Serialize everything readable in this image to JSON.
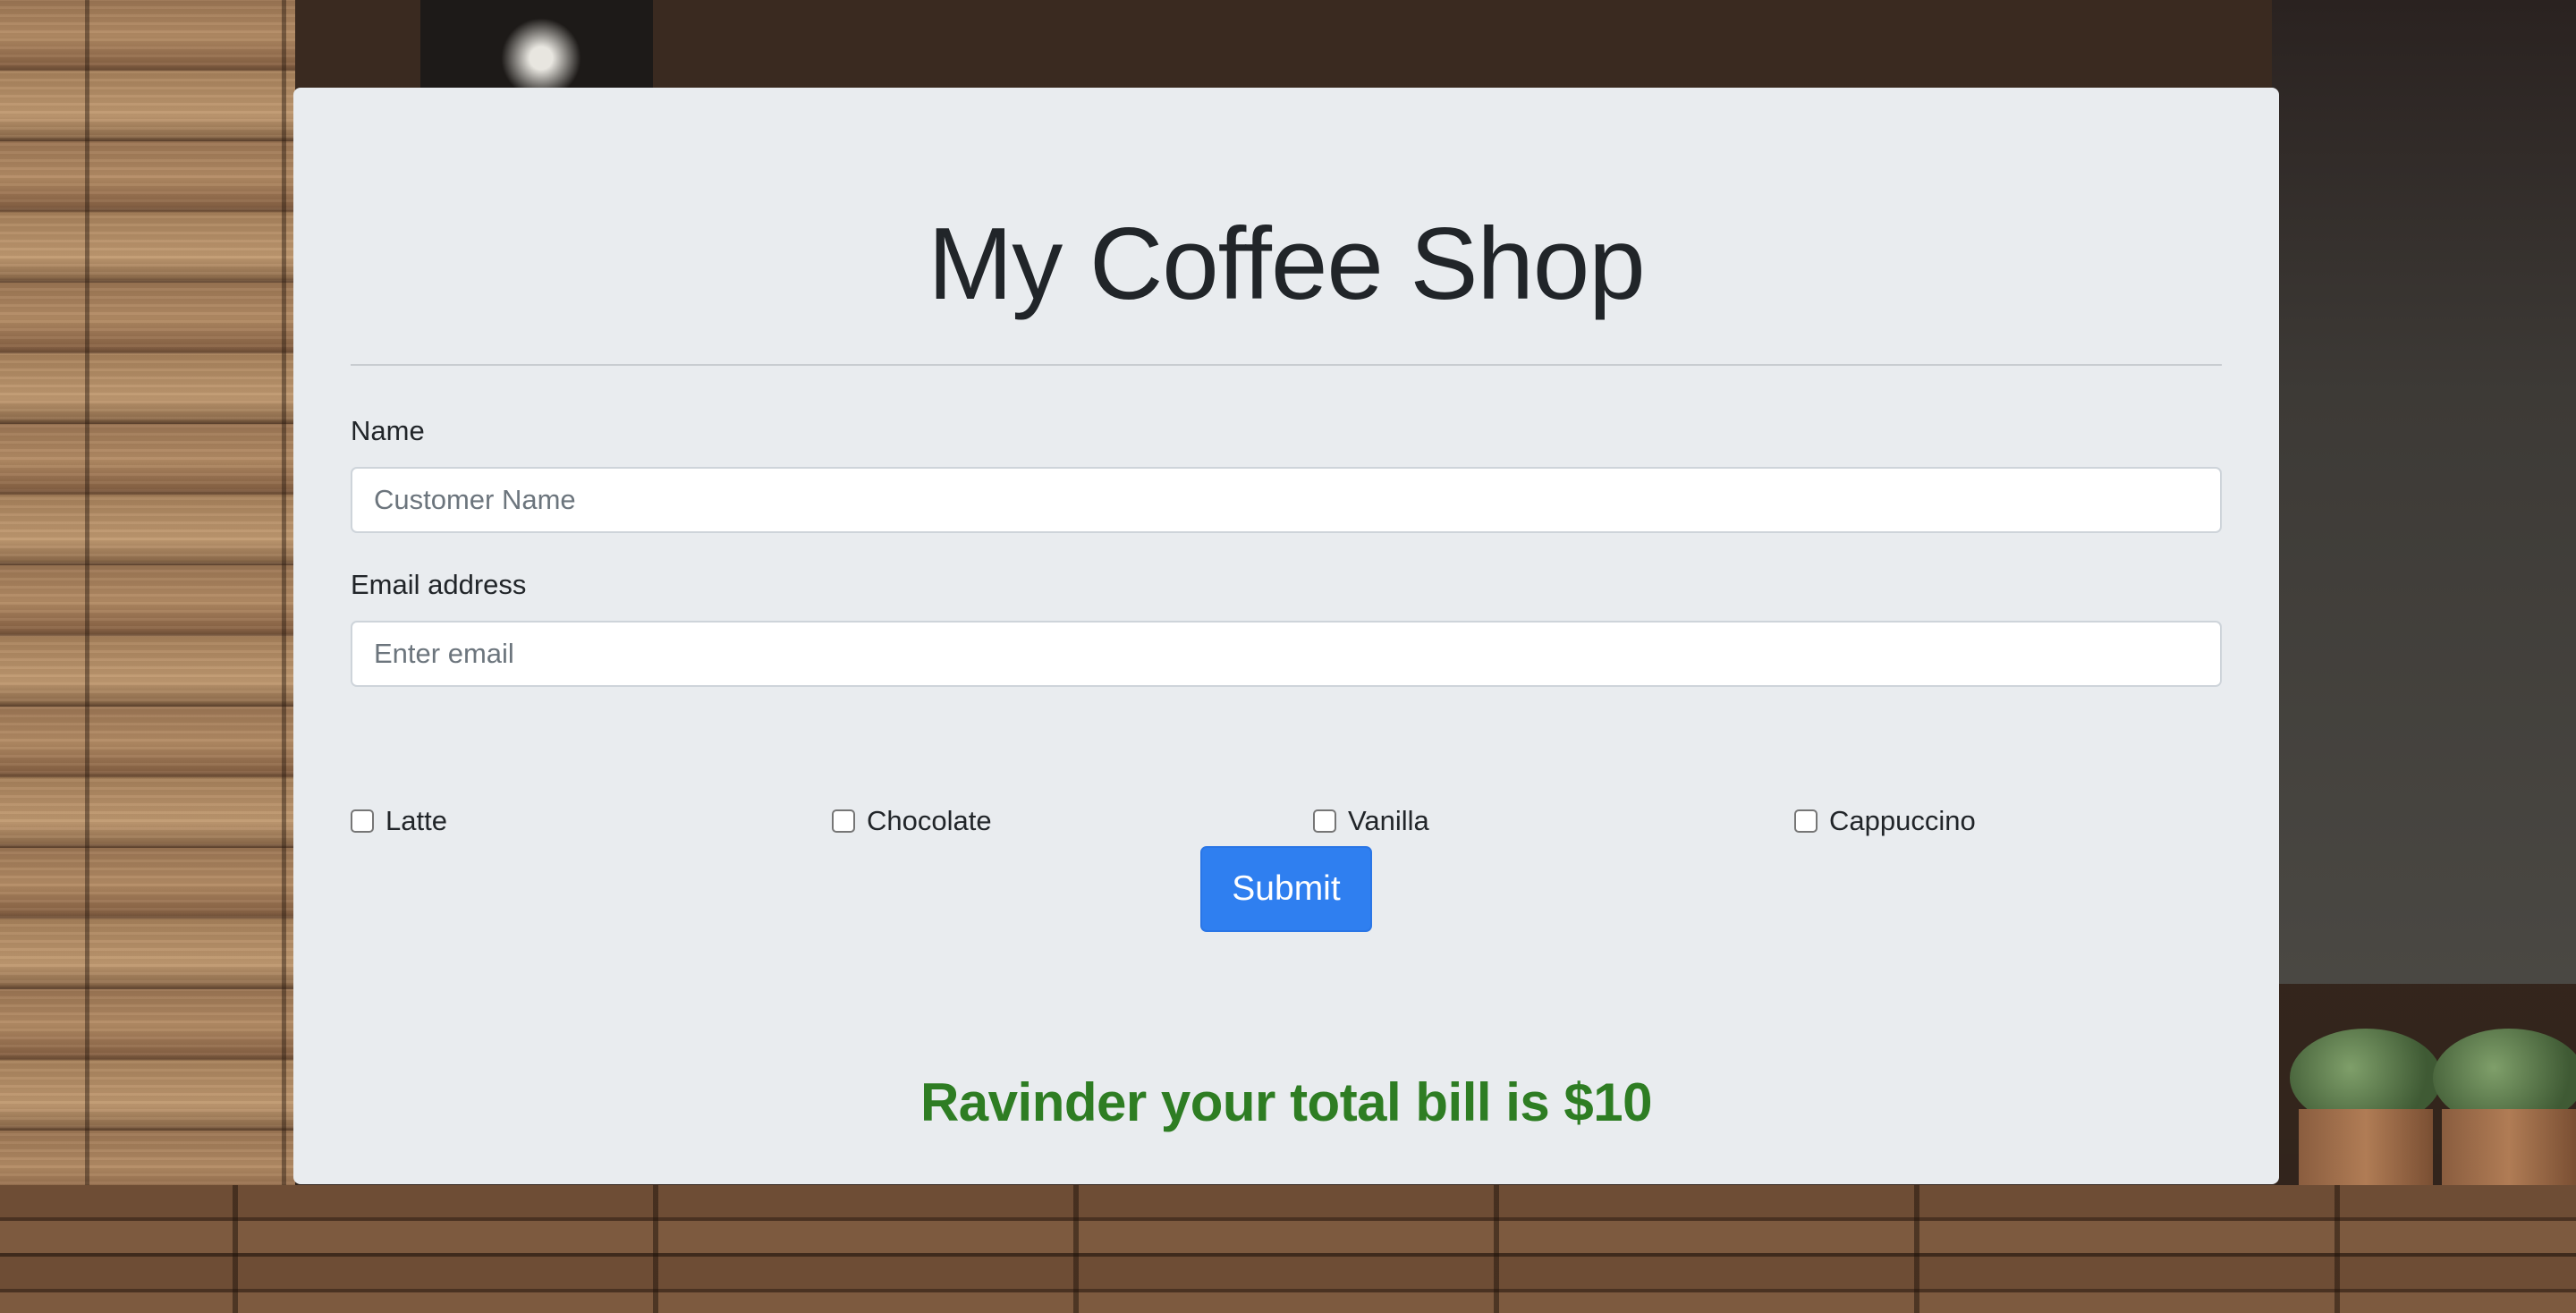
{
  "page": {
    "title": "My Coffee Shop"
  },
  "form": {
    "name_label": "Name",
    "name_placeholder": "Customer Name",
    "name_value": "",
    "email_label": "Email address",
    "email_placeholder": "Enter email",
    "email_value": "",
    "options": [
      {
        "label": "Latte",
        "checked": false
      },
      {
        "label": "Chocolate",
        "checked": false
      },
      {
        "label": "Vanilla",
        "checked": false
      },
      {
        "label": "Cappuccino",
        "checked": false
      }
    ],
    "submit_label": "Submit"
  },
  "result": {
    "message": "Ravinder your total bill is $10",
    "color": "#2e7d23"
  },
  "colors": {
    "card_background": "#e9ecef",
    "button_primary": "#2f7ff0",
    "title_text": "#212529"
  }
}
